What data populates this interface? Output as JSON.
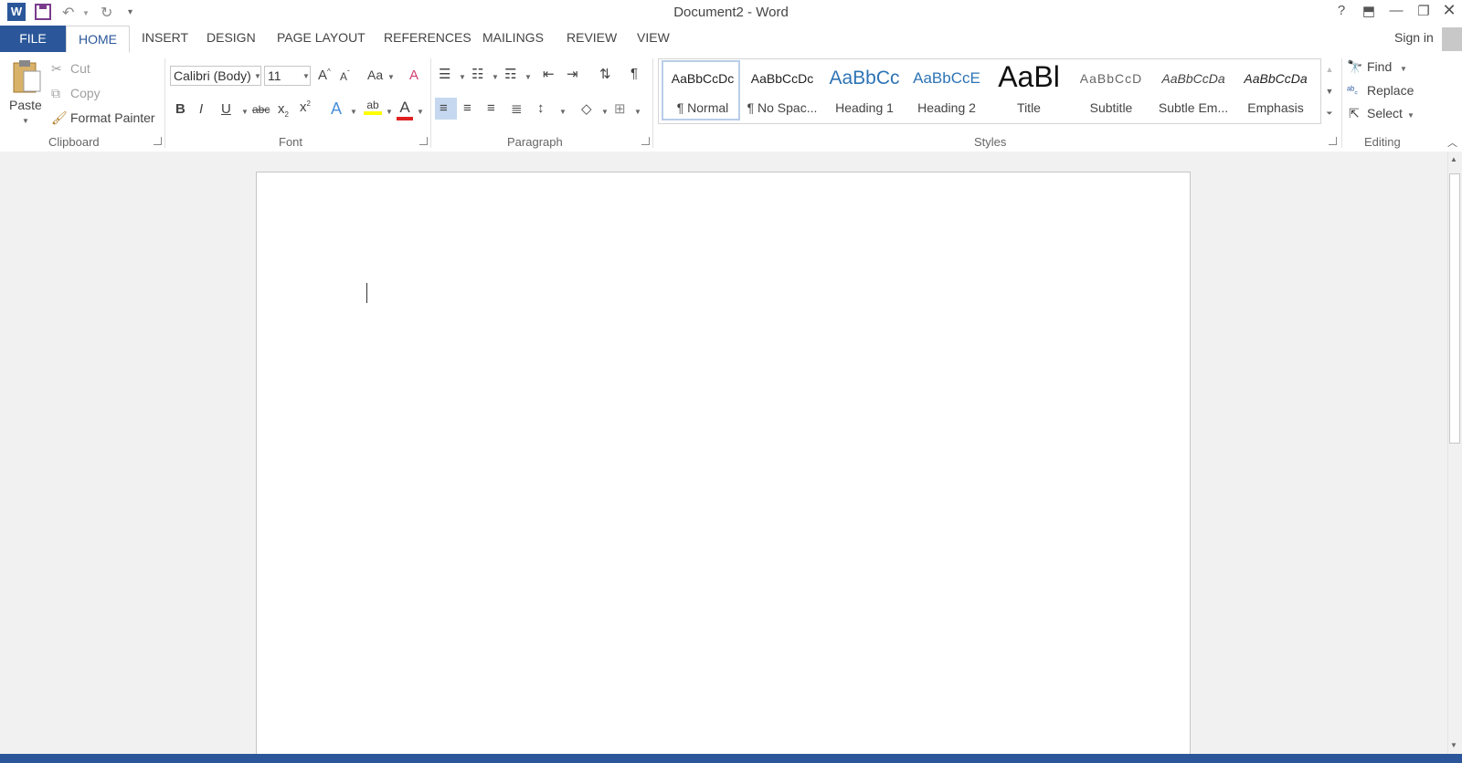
{
  "window": {
    "title": "Document2 - Word"
  },
  "quick_access": {
    "app_icon": "word-logo-icon",
    "save": "save-icon",
    "undo": "undo-icon",
    "redo": "redo-icon",
    "customize": "dropdown-icon"
  },
  "window_controls": {
    "help": "?",
    "ribbon_options": "ribbon-display-icon",
    "minimize": "minimize-icon",
    "restore": "restore-icon",
    "close": "close-icon"
  },
  "tabs": {
    "file": "FILE",
    "home": "HOME",
    "insert": "INSERT",
    "design": "DESIGN",
    "page_layout": "PAGE LAYOUT",
    "references": "REFERENCES",
    "mailings": "MAILINGS",
    "review": "REVIEW",
    "view": "VIEW"
  },
  "account": {
    "sign_in": "Sign in"
  },
  "clipboard": {
    "label": "Clipboard",
    "paste": "Paste",
    "cut": "Cut",
    "copy": "Copy",
    "format_painter": "Format Painter"
  },
  "font": {
    "label": "Font",
    "name": "Calibri (Body)",
    "size": "11",
    "change_case": "Aa"
  },
  "paragraph": {
    "label": "Paragraph",
    "show_marks": "¶"
  },
  "styles": {
    "label": "Styles",
    "items": [
      {
        "sample": "AaBbCcDc",
        "name": "¶ Normal"
      },
      {
        "sample": "AaBbCcDc",
        "name": "¶ No Spac..."
      },
      {
        "sample": "AaBbCc",
        "name": "Heading 1"
      },
      {
        "sample": "AaBbCcE",
        "name": "Heading 2"
      },
      {
        "sample": "AaBl",
        "name": "Title"
      },
      {
        "sample": "AaBbCcD",
        "name": "Subtitle"
      },
      {
        "sample": "AaBbCcDa",
        "name": "Subtle Em..."
      },
      {
        "sample": "AaBbCcDa",
        "name": "Emphasis"
      }
    ],
    "selected": "¶ Normal"
  },
  "editing": {
    "label": "Editing",
    "find": "Find",
    "replace": "Replace",
    "select": "Select"
  },
  "colors": {
    "accent": "#2b579a",
    "highlight": "#ffff00",
    "font_color": "#e02020"
  }
}
